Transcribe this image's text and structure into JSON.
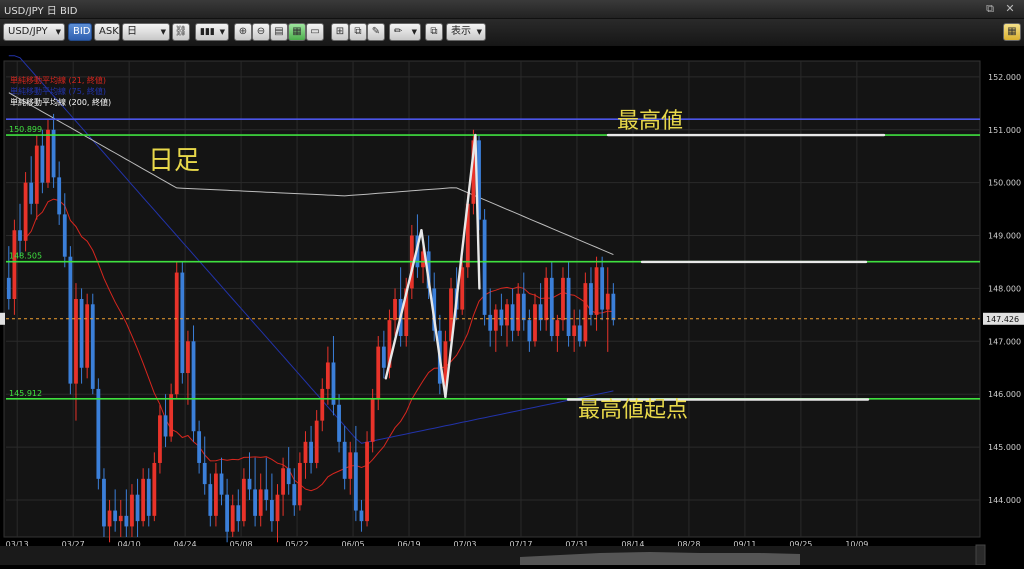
{
  "window": {
    "title": "USD/JPY 日 BID",
    "restore_glyph": "⧉",
    "close_glyph": "✕"
  },
  "toolbar": {
    "symbol": "USD/JPY",
    "bid_label": "BID",
    "ask_label": "ASK",
    "period": "日",
    "display_label": "表示"
  },
  "colors": {
    "bull": "#e8332a",
    "bear": "#3b7fd9",
    "sma21": "#d7261e",
    "sma75": "#2233aa",
    "sma200": "#bdbdbd",
    "hline_green": "#3fe03f",
    "hline_blue": "#4b55e8",
    "annotation": "#e8d84a",
    "price_line": "#f0a030"
  },
  "legend": [
    {
      "label": "単純移動平均線 (21, 終値)",
      "color": "#d7261e"
    },
    {
      "label": "単純移動平均線 (75, 終値)",
      "color": "#2233aa"
    },
    {
      "label": "単純移動平均線 (200, 終値)",
      "color": "#ffffff"
    }
  ],
  "chart_data": {
    "type": "candlestick",
    "title": "USD/JPY 日 BID",
    "ylim": [
      143.3,
      152.3
    ],
    "y_ticks": [
      "152.000",
      "151.000",
      "150.000",
      "149.000",
      "148.000",
      "147.000",
      "146.000",
      "145.000",
      "144.000"
    ],
    "x_ticks": [
      "03/13",
      "03/27",
      "04/10",
      "04/24",
      "05/08",
      "05/22",
      "06/05",
      "06/19",
      "07/03",
      "07/17",
      "07/31",
      "08/14",
      "08/28",
      "09/11",
      "09/25",
      "10/09"
    ],
    "current_price": "147.426",
    "horizontal_levels": [
      {
        "label": "150.899",
        "value": 150.899,
        "color": "green"
      },
      {
        "label": "148.505",
        "value": 148.505,
        "color": "green"
      },
      {
        "label": "145.912",
        "value": 145.912,
        "color": "green"
      },
      {
        "label": "",
        "value": 151.2,
        "color": "blue"
      }
    ],
    "candles": [
      [
        148.2,
        148.8,
        147.6,
        147.8
      ],
      [
        147.8,
        149.3,
        147.5,
        149.1
      ],
      [
        149.1,
        149.6,
        148.6,
        148.9
      ],
      [
        148.9,
        150.2,
        148.7,
        150.0
      ],
      [
        150.0,
        150.5,
        149.4,
        149.6
      ],
      [
        149.6,
        150.9,
        149.3,
        150.7
      ],
      [
        150.7,
        151.0,
        149.8,
        150.0
      ],
      [
        150.0,
        151.2,
        149.9,
        151.0
      ],
      [
        151.0,
        151.3,
        149.9,
        150.1
      ],
      [
        150.1,
        150.4,
        149.2,
        149.4
      ],
      [
        149.4,
        149.8,
        148.4,
        148.6
      ],
      [
        148.6,
        148.8,
        146.0,
        146.2
      ],
      [
        146.2,
        148.1,
        145.5,
        147.8
      ],
      [
        147.8,
        148.0,
        146.2,
        146.5
      ],
      [
        146.5,
        147.9,
        146.3,
        147.7
      ],
      [
        147.7,
        147.9,
        146.0,
        146.1
      ],
      [
        146.1,
        146.3,
        144.2,
        144.4
      ],
      [
        144.4,
        144.6,
        143.3,
        143.5
      ],
      [
        143.5,
        144.0,
        143.2,
        143.8
      ],
      [
        143.8,
        144.2,
        143.4,
        143.6
      ],
      [
        143.6,
        144.0,
        143.3,
        143.7
      ],
      [
        143.7,
        144.2,
        143.3,
        143.5
      ],
      [
        143.5,
        144.3,
        143.3,
        144.1
      ],
      [
        144.1,
        144.4,
        143.3,
        143.6
      ],
      [
        143.6,
        144.6,
        143.5,
        144.4
      ],
      [
        144.4,
        144.6,
        143.5,
        143.7
      ],
      [
        143.7,
        144.9,
        143.6,
        144.7
      ],
      [
        144.7,
        145.8,
        144.5,
        145.6
      ],
      [
        145.6,
        146.0,
        145.0,
        145.2
      ],
      [
        145.2,
        146.2,
        145.1,
        146.0
      ],
      [
        146.0,
        148.5,
        145.9,
        148.3
      ],
      [
        148.3,
        148.5,
        146.2,
        146.4
      ],
      [
        146.4,
        147.2,
        145.8,
        147.0
      ],
      [
        147.0,
        147.3,
        145.1,
        145.3
      ],
      [
        145.3,
        145.5,
        144.5,
        144.7
      ],
      [
        144.7,
        145.2,
        144.1,
        144.3
      ],
      [
        144.3,
        144.5,
        143.5,
        143.7
      ],
      [
        143.7,
        144.7,
        143.5,
        144.5
      ],
      [
        144.5,
        144.8,
        143.9,
        144.1
      ],
      [
        144.1,
        144.4,
        143.2,
        143.4
      ],
      [
        143.4,
        144.1,
        143.3,
        143.9
      ],
      [
        143.9,
        144.2,
        143.4,
        143.6
      ],
      [
        143.6,
        144.6,
        143.5,
        144.4
      ],
      [
        144.4,
        144.9,
        144.0,
        144.2
      ],
      [
        144.2,
        144.8,
        143.5,
        143.7
      ],
      [
        143.7,
        144.5,
        143.5,
        144.2
      ],
      [
        144.2,
        144.8,
        143.8,
        144.0
      ],
      [
        144.0,
        144.5,
        143.4,
        143.6
      ],
      [
        143.6,
        144.3,
        143.2,
        144.1
      ],
      [
        144.1,
        144.8,
        143.7,
        144.6
      ],
      [
        144.6,
        145.0,
        144.1,
        144.3
      ],
      [
        144.3,
        144.6,
        143.7,
        143.9
      ],
      [
        143.9,
        144.9,
        143.8,
        144.7
      ],
      [
        144.7,
        145.3,
        144.4,
        145.1
      ],
      [
        145.1,
        145.4,
        144.5,
        144.7
      ],
      [
        144.7,
        145.7,
        144.6,
        145.5
      ],
      [
        145.5,
        146.3,
        145.3,
        146.1
      ],
      [
        146.1,
        146.9,
        145.8,
        146.6
      ],
      [
        146.6,
        147.1,
        145.6,
        145.8
      ],
      [
        145.8,
        146.0,
        144.9,
        145.1
      ],
      [
        145.1,
        145.4,
        144.2,
        144.4
      ],
      [
        144.4,
        145.1,
        144.1,
        144.9
      ],
      [
        144.9,
        145.4,
        143.6,
        143.8
      ],
      [
        143.8,
        144.0,
        143.4,
        143.6
      ],
      [
        143.6,
        145.3,
        143.5,
        145.1
      ],
      [
        145.1,
        146.1,
        144.9,
        145.9
      ],
      [
        145.9,
        147.1,
        145.7,
        146.9
      ],
      [
        146.9,
        147.2,
        146.3,
        146.5
      ],
      [
        146.5,
        147.6,
        146.3,
        147.4
      ],
      [
        147.4,
        148.0,
        147.1,
        147.8
      ],
      [
        147.8,
        148.4,
        146.9,
        147.1
      ],
      [
        147.1,
        148.2,
        146.9,
        148.0
      ],
      [
        148.0,
        149.2,
        147.8,
        149.0
      ],
      [
        149.0,
        149.4,
        148.2,
        148.4
      ],
      [
        148.4,
        148.9,
        148.1,
        148.7
      ],
      [
        148.7,
        149.0,
        147.8,
        148.0
      ],
      [
        148.0,
        148.3,
        147.0,
        147.2
      ],
      [
        147.2,
        147.5,
        146.0,
        146.2
      ],
      [
        146.2,
        147.2,
        145.9,
        147.0
      ],
      [
        147.0,
        148.2,
        146.9,
        148.0
      ],
      [
        148.0,
        148.4,
        147.4,
        147.6
      ],
      [
        147.6,
        148.6,
        147.5,
        148.4
      ],
      [
        148.4,
        149.8,
        148.2,
        149.6
      ],
      [
        149.6,
        151.0,
        149.4,
        150.8
      ],
      [
        150.8,
        150.9,
        149.1,
        149.3
      ],
      [
        149.3,
        149.5,
        147.3,
        147.5
      ],
      [
        147.5,
        148.0,
        146.9,
        147.2
      ],
      [
        147.2,
        147.7,
        146.8,
        147.6
      ],
      [
        147.6,
        147.9,
        147.1,
        147.3
      ],
      [
        147.3,
        147.8,
        146.9,
        147.7
      ],
      [
        147.7,
        148.0,
        147.0,
        147.2
      ],
      [
        147.2,
        148.1,
        147.1,
        147.9
      ],
      [
        147.9,
        148.3,
        147.2,
        147.4
      ],
      [
        147.4,
        147.6,
        146.8,
        147.0
      ],
      [
        147.0,
        147.9,
        146.9,
        147.7
      ],
      [
        147.7,
        148.1,
        147.2,
        147.4
      ],
      [
        147.4,
        148.4,
        147.2,
        148.2
      ],
      [
        148.2,
        148.5,
        147.0,
        147.1
      ],
      [
        147.1,
        147.5,
        146.8,
        147.4
      ],
      [
        147.4,
        148.4,
        147.2,
        148.2
      ],
      [
        148.2,
        148.5,
        146.9,
        147.1
      ],
      [
        147.1,
        147.6,
        146.8,
        147.3
      ],
      [
        147.3,
        147.6,
        146.9,
        147.0
      ],
      [
        147.0,
        148.3,
        146.9,
        148.1
      ],
      [
        148.1,
        148.4,
        147.3,
        147.5
      ],
      [
        147.5,
        148.6,
        147.2,
        148.4
      ],
      [
        148.4,
        148.6,
        147.4,
        147.6
      ],
      [
        147.6,
        148.4,
        146.8,
        147.9
      ],
      [
        147.9,
        148.1,
        147.3,
        147.4
      ]
    ]
  },
  "annotations": {
    "nichiashi": "日足",
    "saitakane": "最高値",
    "saitakane_kiten": "最高値起点"
  }
}
